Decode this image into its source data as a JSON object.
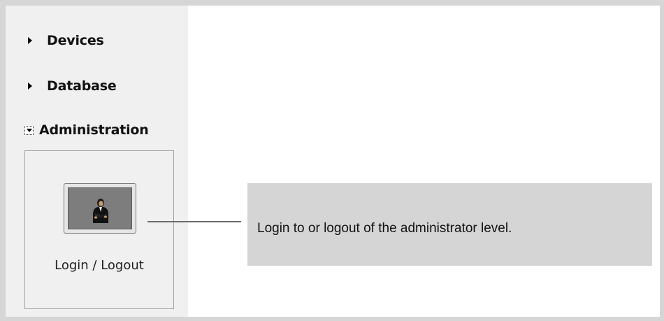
{
  "sidebar": {
    "items": [
      {
        "label": "Devices",
        "expanded": false
      },
      {
        "label": "Database",
        "expanded": false
      },
      {
        "label": "Administration",
        "expanded": true
      }
    ]
  },
  "admin_panel": {
    "login_button": {
      "label": "Login / Logout",
      "icon": "administrator-person-icon"
    }
  },
  "callout": {
    "text": "Login to or logout of the administrator level."
  },
  "colors": {
    "frame": "#d6d6d6",
    "sidebar_bg": "#f0f0f0",
    "callout_bg": "#d5d5d5",
    "callout_line": "#6b6b6b",
    "button_icon_bg": "#7d7d7d"
  }
}
